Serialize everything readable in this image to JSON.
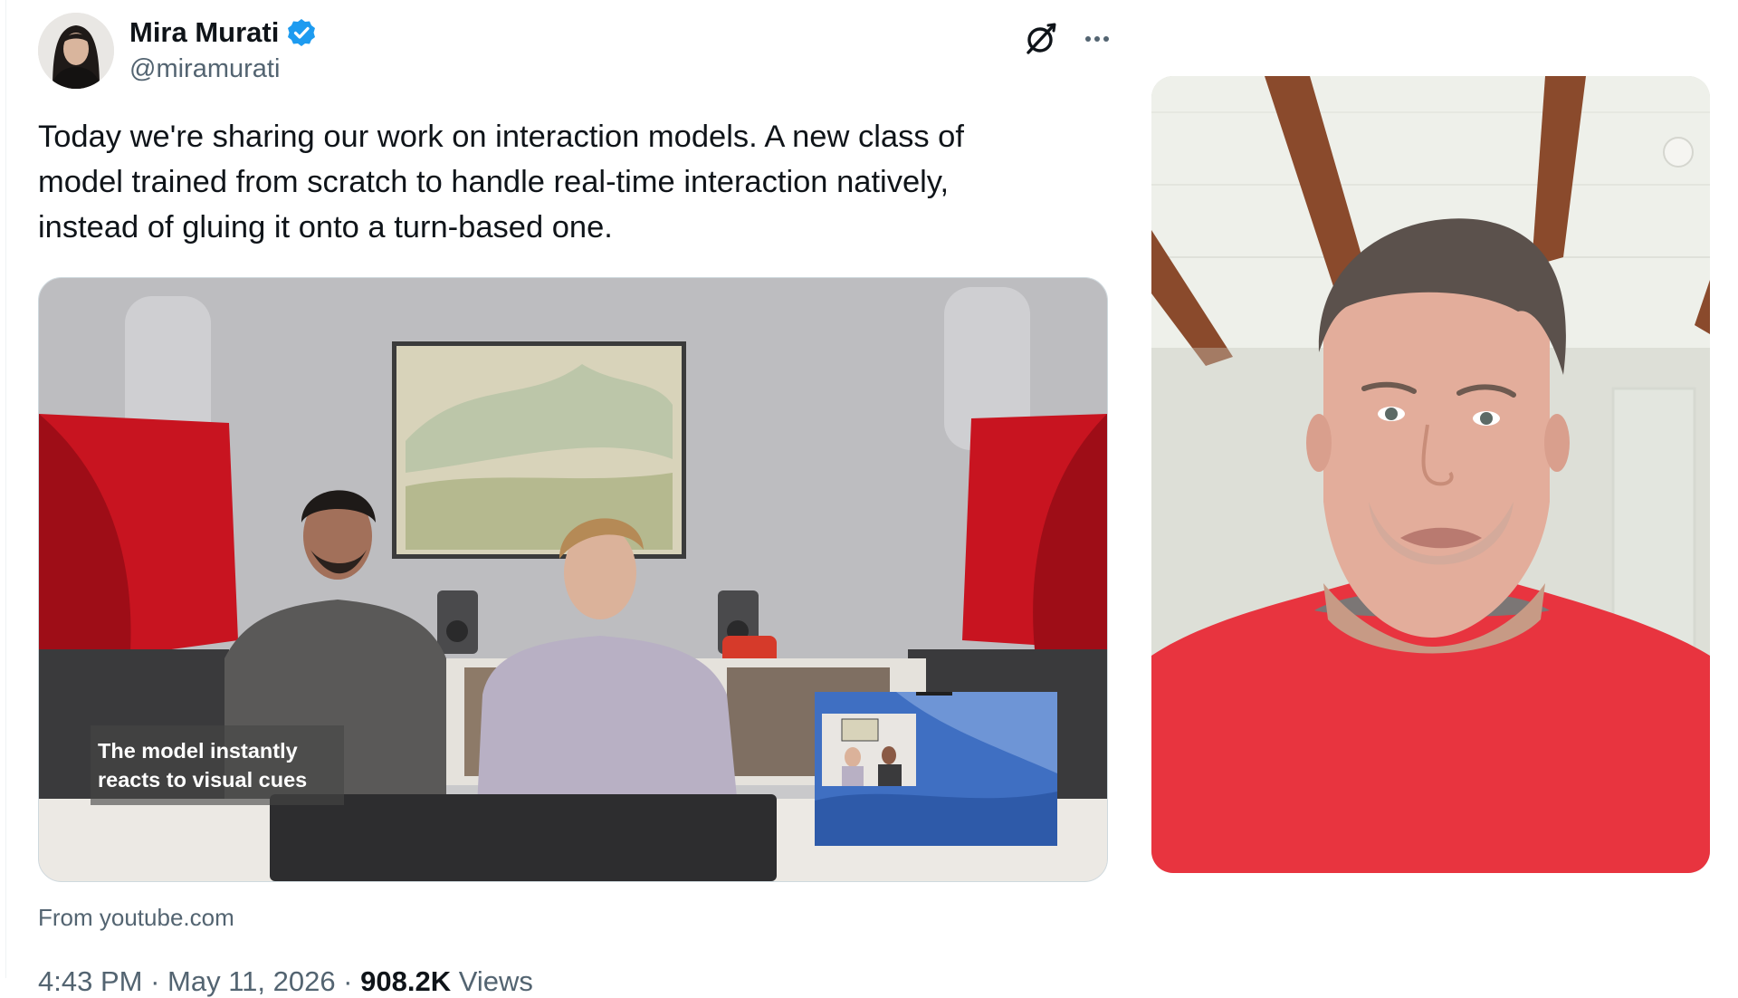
{
  "author": {
    "name": "Mira Murati",
    "handle": "@miramurati"
  },
  "icons": {
    "verified": "verified-badge-icon",
    "grok": "grok-icon",
    "more": "more-options-icon"
  },
  "tweet": {
    "text_lines": [
      "Today we're sharing our work on interaction models. A new class of",
      "model trained from scratch to handle real-time interaction natively,",
      "instead of gluing it onto a turn-based one."
    ]
  },
  "video": {
    "caption_lines": [
      "The model instantly",
      "reacts to visual cues"
    ]
  },
  "card": {
    "source": "From youtube.com"
  },
  "meta": {
    "time": "4:43 PM",
    "separator": " · ",
    "date": "May 11, 2026",
    "views_count": "908.2K",
    "views_label": "Views"
  },
  "colors": {
    "verified_blue": "#1d9bf0",
    "text_primary": "#0f1419",
    "text_secondary": "#536471",
    "sweater_red": "#e8343f",
    "speaker_red": "#c81420"
  }
}
